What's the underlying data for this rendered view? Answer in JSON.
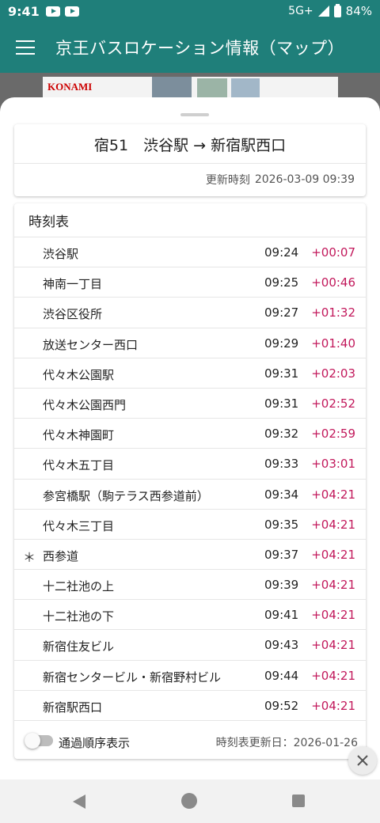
{
  "status_bar": {
    "time": "9:41",
    "network": "5G+",
    "battery": "84%"
  },
  "app_bar": {
    "title": "京王バスロケーション情報（マップ）"
  },
  "ad": {
    "brand": "KONAMI"
  },
  "route": {
    "title": "宿51　渋谷駅 → 新宿駅西口",
    "updated_label": "更新時刻",
    "updated_value": "2026-03-09 09:39"
  },
  "timetable": {
    "heading": "時刻表",
    "rows": [
      {
        "marker": "",
        "stop": "渋谷駅",
        "time": "09:24",
        "delay": "+00:07"
      },
      {
        "marker": "",
        "stop": "神南一丁目",
        "time": "09:25",
        "delay": "+00:46"
      },
      {
        "marker": "",
        "stop": "渋谷区役所",
        "time": "09:27",
        "delay": "+01:32"
      },
      {
        "marker": "",
        "stop": "放送センター西口",
        "time": "09:29",
        "delay": "+01:40"
      },
      {
        "marker": "",
        "stop": "代々木公園駅",
        "time": "09:31",
        "delay": "+02:03"
      },
      {
        "marker": "",
        "stop": "代々木公園西門",
        "time": "09:31",
        "delay": "+02:52"
      },
      {
        "marker": "",
        "stop": "代々木神園町",
        "time": "09:32",
        "delay": "+02:59"
      },
      {
        "marker": "",
        "stop": "代々木五丁目",
        "time": "09:33",
        "delay": "+03:01"
      },
      {
        "marker": "",
        "stop": "参宮橋駅（駒テラス西参道前）",
        "time": "09:34",
        "delay": "+04:21"
      },
      {
        "marker": "",
        "stop": "代々木三丁目",
        "time": "09:35",
        "delay": "+04:21"
      },
      {
        "marker": "＊",
        "stop": "西参道",
        "time": "09:37",
        "delay": "+04:21"
      },
      {
        "marker": "",
        "stop": "十二社池の上",
        "time": "09:39",
        "delay": "+04:21"
      },
      {
        "marker": "",
        "stop": "十二社池の下",
        "time": "09:41",
        "delay": "+04:21"
      },
      {
        "marker": "",
        "stop": "新宿住友ビル",
        "time": "09:43",
        "delay": "+04:21"
      },
      {
        "marker": "",
        "stop": "新宿センタービル・新宿野村ビル",
        "time": "09:44",
        "delay": "+04:21"
      },
      {
        "marker": "",
        "stop": "新宿駅西口",
        "time": "09:52",
        "delay": "+04:21"
      }
    ],
    "toggle_label": "通過順序表示",
    "toggle_on": false,
    "updated_text": "時刻表更新日：2026-01-26"
  },
  "colors": {
    "app_bar": "#1f7f7a",
    "delay": "#c2185b"
  },
  "icons": {
    "menu": "hamburger-menu-icon",
    "close": "close-icon",
    "nav_back": "back-triangle-icon",
    "nav_home": "home-circle-icon",
    "nav_recent": "recents-square-icon"
  }
}
